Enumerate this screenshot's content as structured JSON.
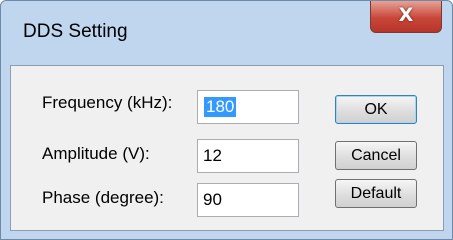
{
  "window": {
    "title": "DDS Setting",
    "close_symbol": "X"
  },
  "form": {
    "frequency_label": "Frequency (kHz):",
    "frequency_value": "180",
    "amplitude_label": "Amplitude (V):",
    "amplitude_value": "12",
    "phase_label": "Phase (degree):",
    "phase_value": "90"
  },
  "buttons": {
    "ok": "OK",
    "cancel": "Cancel",
    "default": "Default"
  },
  "colors": {
    "selection": "#3399ff",
    "close_button": "#c8463a",
    "frame": "#bfd6ee"
  }
}
